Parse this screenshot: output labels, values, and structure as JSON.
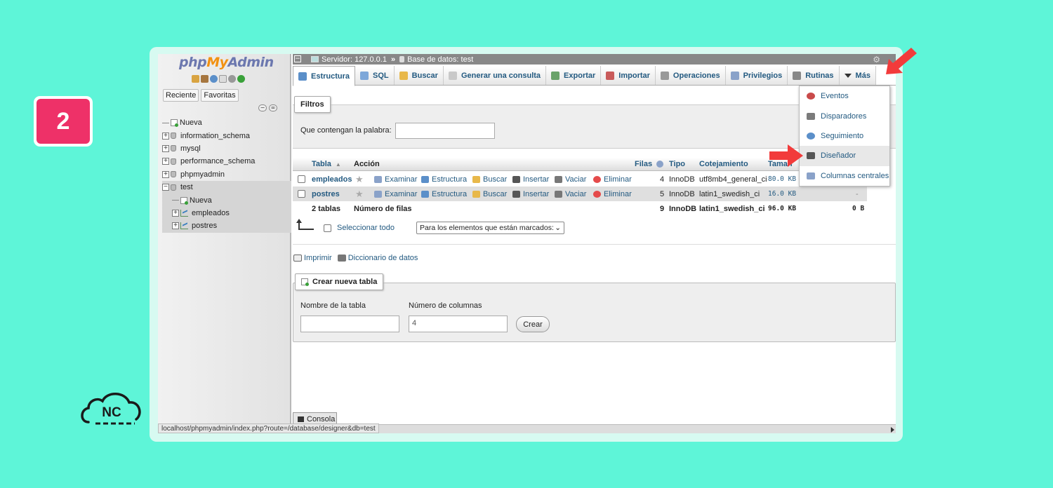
{
  "step_number": "2",
  "brand_logo": "NC",
  "nav": {
    "logo_php": "php",
    "logo_my": "My",
    "logo_admin": "Admin",
    "tabs": [
      "Reciente",
      "Favoritas"
    ],
    "tree": [
      {
        "label": "Nueva",
        "kind": "new",
        "indent": 0
      },
      {
        "label": "information_schema",
        "kind": "db",
        "indent": 0
      },
      {
        "label": "mysql",
        "kind": "db",
        "indent": 0
      },
      {
        "label": "performance_schema",
        "kind": "db",
        "indent": 0
      },
      {
        "label": "phpmyadmin",
        "kind": "db",
        "indent": 0
      },
      {
        "label": "test",
        "kind": "db-open",
        "indent": 0
      },
      {
        "label": "Nueva",
        "kind": "new",
        "indent": 1
      },
      {
        "label": "empleados",
        "kind": "table",
        "indent": 1
      },
      {
        "label": "postres",
        "kind": "table",
        "indent": 1
      }
    ]
  },
  "breadcrumb": {
    "server": "Servidor: 127.0.0.1",
    "separator": "»",
    "database": "Base de datos: test"
  },
  "tabs": [
    {
      "label": "Estructura",
      "active": true,
      "color": "#5b8fc9"
    },
    {
      "label": "SQL",
      "active": false,
      "color": "#7da7d9"
    },
    {
      "label": "Buscar",
      "active": false,
      "color": "#e8b84a"
    },
    {
      "label": "Generar una consulta",
      "active": false,
      "color": "#c9c9c9"
    },
    {
      "label": "Exportar",
      "active": false,
      "color": "#6aa36a"
    },
    {
      "label": "Importar",
      "active": false,
      "color": "#c95b5b"
    },
    {
      "label": "Operaciones",
      "active": false,
      "color": "#999999"
    },
    {
      "label": "Privilegios",
      "active": false,
      "color": "#8aa2c9"
    },
    {
      "label": "Rutinas",
      "active": false,
      "color": "#888888"
    },
    {
      "label": "Más",
      "active": false,
      "color": "#333333"
    }
  ],
  "filters": {
    "legend": "Filtros",
    "label": "Que contengan la palabra:",
    "value": ""
  },
  "table": {
    "headers": {
      "tabla": "Tabla",
      "accion": "Acción",
      "filas": "Filas",
      "tipo": "Tipo",
      "cotejamiento": "Cotejamiento",
      "tamano": "Tamañ"
    },
    "actions": [
      "Examinar",
      "Estructura",
      "Buscar",
      "Insertar",
      "Vaciar",
      "Eliminar"
    ],
    "rows": [
      {
        "name": "empleados",
        "rows": "4",
        "type": "InnoDB",
        "collation": "utf8mb4_general_ci",
        "size": "80.0 KB",
        "overhead": ""
      },
      {
        "name": "postres",
        "rows": "5",
        "type": "InnoDB",
        "collation": "latin1_swedish_ci",
        "size": "16.0 KB",
        "overhead": "-"
      }
    ],
    "total": {
      "label": "2 tablas",
      "action": "Número de filas",
      "rows": "9",
      "type": "InnoDB",
      "collation": "latin1_swedish_ci",
      "size": "96.0 KB",
      "overhead": "0 B"
    }
  },
  "select_all": {
    "label": "Seleccionar todo",
    "select_value": "Para los elementos que están marcados:"
  },
  "print_links": {
    "print": "Imprimir",
    "dictionary": "Diccionario de datos"
  },
  "create": {
    "legend": "Crear nueva tabla",
    "name_label": "Nombre de la tabla",
    "name_value": "",
    "cols_label": "Número de columnas",
    "cols_value": "4",
    "button": "Crear"
  },
  "dropdown": [
    {
      "label": "Eventos",
      "color": "#c94a4a",
      "highlighted": false
    },
    {
      "label": "Disparadores",
      "color": "#7b7b7b",
      "highlighted": false
    },
    {
      "label": "Seguimiento",
      "color": "#5b8fc9",
      "highlighted": false
    },
    {
      "label": "Diseñador",
      "color": "#555555",
      "highlighted": true
    },
    {
      "label": "Columnas centrales",
      "color": "#8aa2c9",
      "highlighted": false
    }
  ],
  "console": "Consola",
  "status_url": "localhost/phpmyadmin/index.php?route=/database/designer&db=test",
  "accent_color": "#ee3168",
  "background_color": "#5ef5d8"
}
